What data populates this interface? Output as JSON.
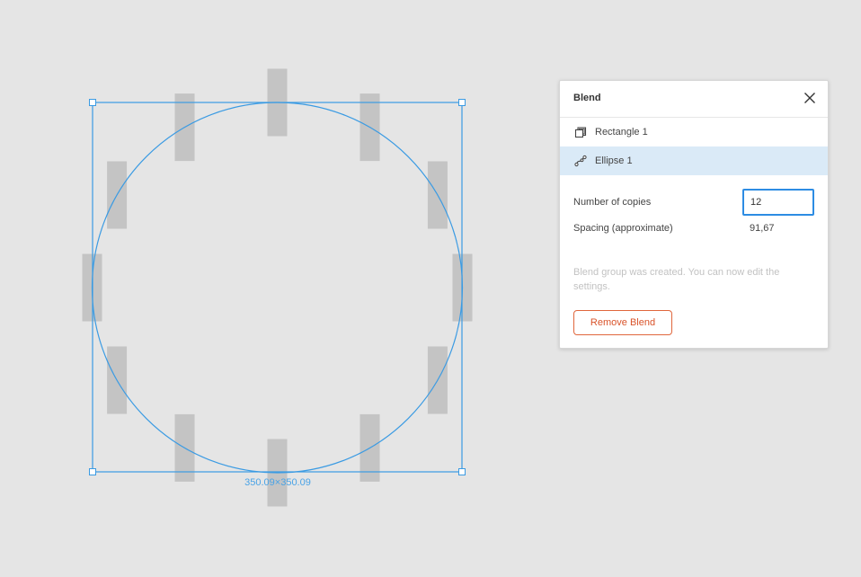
{
  "canvas": {
    "selection_size_label": "350.09×350.09",
    "copies": 12,
    "colors": {
      "rect_fill": "#c4c4c4",
      "selection": "#3b9be3",
      "background": "#e5e5e5"
    }
  },
  "blend_panel": {
    "title": "Blend",
    "layers": [
      {
        "label": "Rectangle 1",
        "icon": "copy-stack-icon",
        "selected": false
      },
      {
        "label": "Ellipse 1",
        "icon": "path-curve-icon",
        "selected": true
      }
    ],
    "number_of_copies_label": "Number of copies",
    "number_of_copies_value": "12",
    "spacing_label": "Spacing (approximate)",
    "spacing_value": "91,67",
    "note": "Blend group was created. You can now edit the settings.",
    "remove_button_label": "Remove Blend",
    "colors": {
      "accent": "#2d8ce3",
      "danger": "#d9532a",
      "selected_row": "#daeaf7"
    }
  }
}
